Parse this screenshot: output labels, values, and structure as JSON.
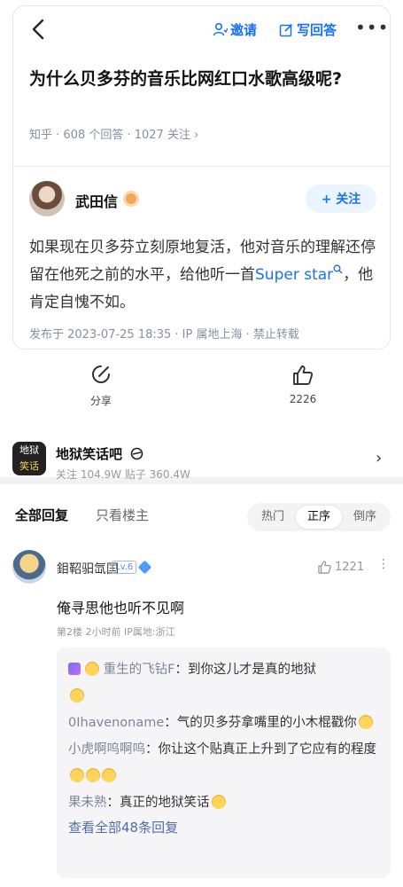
{
  "header": {
    "invite_label": "邀请",
    "write_answer_label": "写回答"
  },
  "question": {
    "title": "为什么贝多芬的音乐比网红口水歌高级呢?",
    "meta": "知乎 · 608 个回答 · 1027 关注 ›"
  },
  "answer": {
    "author": "武田信",
    "follow_label": "+ 关注",
    "text_before_link": "如果现在贝多芬立刻原地复活，他对音乐的理解还停留在他死之前的水平，给他听一首",
    "link_text": "Super star",
    "text_after_link": "，他肯定自愧不如。",
    "meta": "发布于 2023-07-25 18:35 · IP 属地上海 · 禁止转载"
  },
  "actions": {
    "share_label": "分享",
    "like_count": "2226"
  },
  "forum": {
    "icon_text_top": "地狱",
    "icon_text_bottom": "笑话",
    "name": "地狱笑话吧",
    "stats": "关注 104.9W   贴子 360.4W"
  },
  "tabs": {
    "all_label": "全部回复",
    "host_only_label": "只看楼主",
    "sort_options": [
      "热门",
      "正序",
      "倒序"
    ],
    "sort_selected": "正序"
  },
  "comment": {
    "name": "鉬鞀驲氙囯",
    "level": "Lv.6",
    "likes": "1221",
    "text": "俺寻思他也听不见啊",
    "meta": "第2楼  2小时前  IP属地:浙江",
    "replies": [
      {
        "name": "重生的飞钻F",
        "sep": "：",
        "text": "到你这儿才是真的地狱"
      },
      {
        "name": "0Ihavenoname",
        "sep": "：",
        "text": "气的贝多芬拿嘴里的小木棍戳你"
      },
      {
        "name": "小虎啊呜啊呜",
        "sep": "：",
        "text": "你让这个贴真正上升到了它应有的程度"
      },
      {
        "name": "果未熟",
        "sep": "：",
        "text": "真正的地狱笑话"
      }
    ],
    "view_all_label": "查看全部48条回复"
  }
}
